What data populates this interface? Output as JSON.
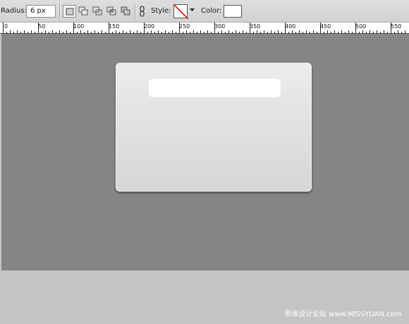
{
  "options_bar": {
    "radius_label": "Radius:",
    "radius_value": "6 px",
    "style_label": "Style:",
    "color_label": "Color:",
    "shape_modes": [
      "new-layer",
      "add",
      "subtract",
      "intersect",
      "exclude"
    ],
    "icons": [
      "new-layer-icon",
      "add-to-shape-icon",
      "subtract-shape-icon",
      "intersect-shape-icon",
      "exclude-overlap-icon",
      "link-icon",
      "no-style-icon",
      "dropdown-arrow-icon"
    ],
    "color_value": "#ffffff"
  },
  "ruler": {
    "labels": [
      "0",
      "50",
      "100",
      "150",
      "200",
      "250",
      "300",
      "350",
      "400",
      "450",
      "500",
      "550"
    ]
  },
  "canvas": {
    "background": "#858585",
    "shape_gradient": [
      "#ececec",
      "#d6d6d6"
    ],
    "inset_color": "#ffffff"
  },
  "watermark": {
    "text": "思缘设计论坛 www.MISSYUAN.com"
  }
}
